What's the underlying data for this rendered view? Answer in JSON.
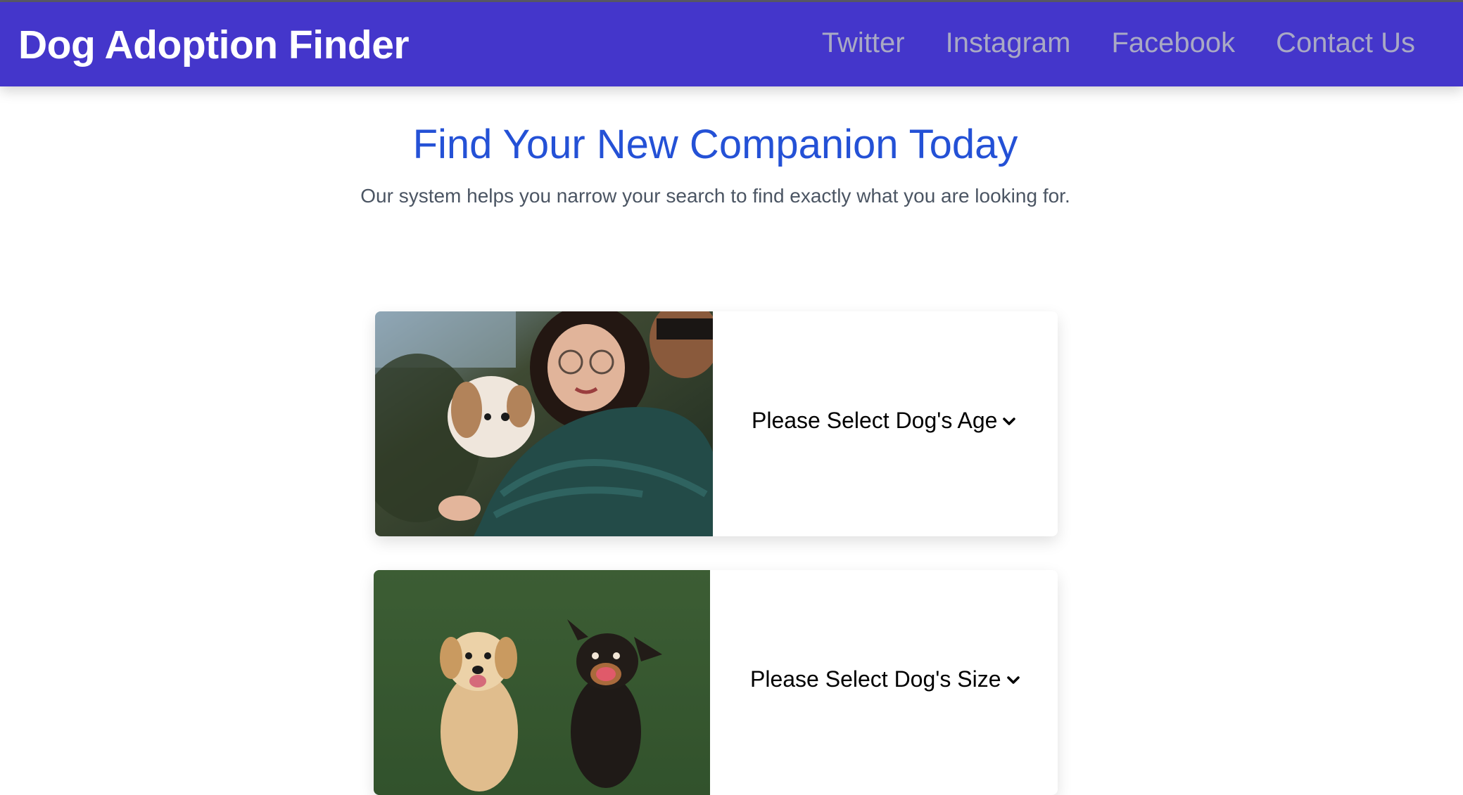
{
  "navbar": {
    "brand": "Dog Adoption Finder",
    "links": [
      "Twitter",
      "Instagram",
      "Facebook",
      "Contact Us"
    ],
    "background": "#4436cb"
  },
  "hero": {
    "title": "Find Your New Companion Today",
    "subtitle": "Our system helps you narrow your search to find exactly what you are looking for."
  },
  "cards": [
    {
      "select_label": "Please Select Dog's Age",
      "icon": "chevron-down-icon"
    },
    {
      "select_label": "Please Select Dog's Size",
      "icon": "chevron-down-icon"
    }
  ],
  "colors": {
    "title": "#2451d6",
    "nav_link": "#a9a9c4",
    "subtitle": "#4b5563"
  }
}
